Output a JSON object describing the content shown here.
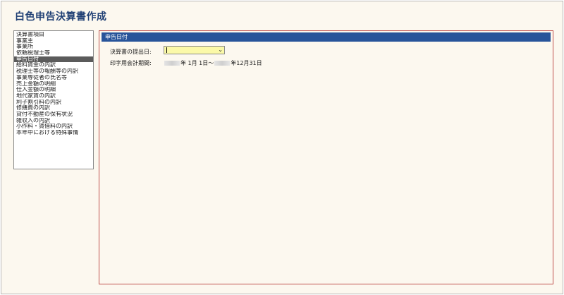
{
  "window": {
    "title": "白色申告決算書作成"
  },
  "sidebar": {
    "items": [
      {
        "label": "決算書項目",
        "selected": false
      },
      {
        "label": "事業主",
        "selected": false
      },
      {
        "label": "事業所",
        "selected": false
      },
      {
        "label": "依頼税理士等",
        "selected": false
      },
      {
        "label": "申告日付",
        "selected": true
      },
      {
        "label": "給料賃金の内訳",
        "selected": false
      },
      {
        "label": "税理士等の報酬等の内訳",
        "selected": false
      },
      {
        "label": "事業専従者の氏名等",
        "selected": false
      },
      {
        "label": "売上金額の明細",
        "selected": false
      },
      {
        "label": "仕入金額の明細",
        "selected": false
      },
      {
        "label": "地代家賃の内訳",
        "selected": false
      },
      {
        "label": "利子割引料の内訳",
        "selected": false
      },
      {
        "label": "修繕費の内訳",
        "selected": false
      },
      {
        "label": "貸付不動産の保有状況",
        "selected": false
      },
      {
        "label": "雑収入の内訳",
        "selected": false
      },
      {
        "label": "小作料・賃借料の内訳",
        "selected": false
      },
      {
        "label": "本年中における特殊事情",
        "selected": false
      }
    ]
  },
  "panel": {
    "header": "申告日付",
    "submit_date_label": "決算書の提出日:",
    "submit_date_value": "",
    "period_label": "印字用会計期間:",
    "period_start_text": "年  1月  1日～",
    "period_end_text": "年12月31日"
  },
  "colors": {
    "title": "#1f3f74",
    "panel_header_bg": "#27549a",
    "panel_border": "#c0504d",
    "selected_item_bg": "#5b5b5b",
    "combo_bg": "#fbf9a8",
    "background": "#fcf8ef"
  }
}
